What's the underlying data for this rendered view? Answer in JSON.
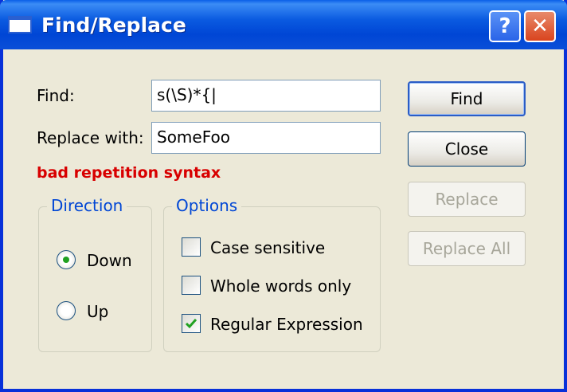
{
  "window": {
    "title": "Find/Replace",
    "help_glyph": "?",
    "close_glyph": "✕"
  },
  "form": {
    "find_label": "Find:",
    "find_value": "s(\\S)*{|",
    "replace_label": "Replace with:",
    "replace_value": "SomeFoo",
    "error_text": "bad repetition syntax"
  },
  "buttons": {
    "find": "Find",
    "close": "Close",
    "replace": "Replace",
    "replace_all": "Replace All"
  },
  "direction": {
    "title": "Direction",
    "options": [
      {
        "label": "Down",
        "selected": true
      },
      {
        "label": "Up",
        "selected": false
      }
    ]
  },
  "options": {
    "title": "Options",
    "items": [
      {
        "label": "Case sensitive",
        "checked": false
      },
      {
        "label": "Whole words only",
        "checked": false
      },
      {
        "label": "Regular Expression",
        "checked": true
      }
    ]
  },
  "colors": {
    "title_bar": "#0a5ae0",
    "error": "#d80000",
    "group_title": "#0046d5",
    "face": "#ece9d8"
  }
}
